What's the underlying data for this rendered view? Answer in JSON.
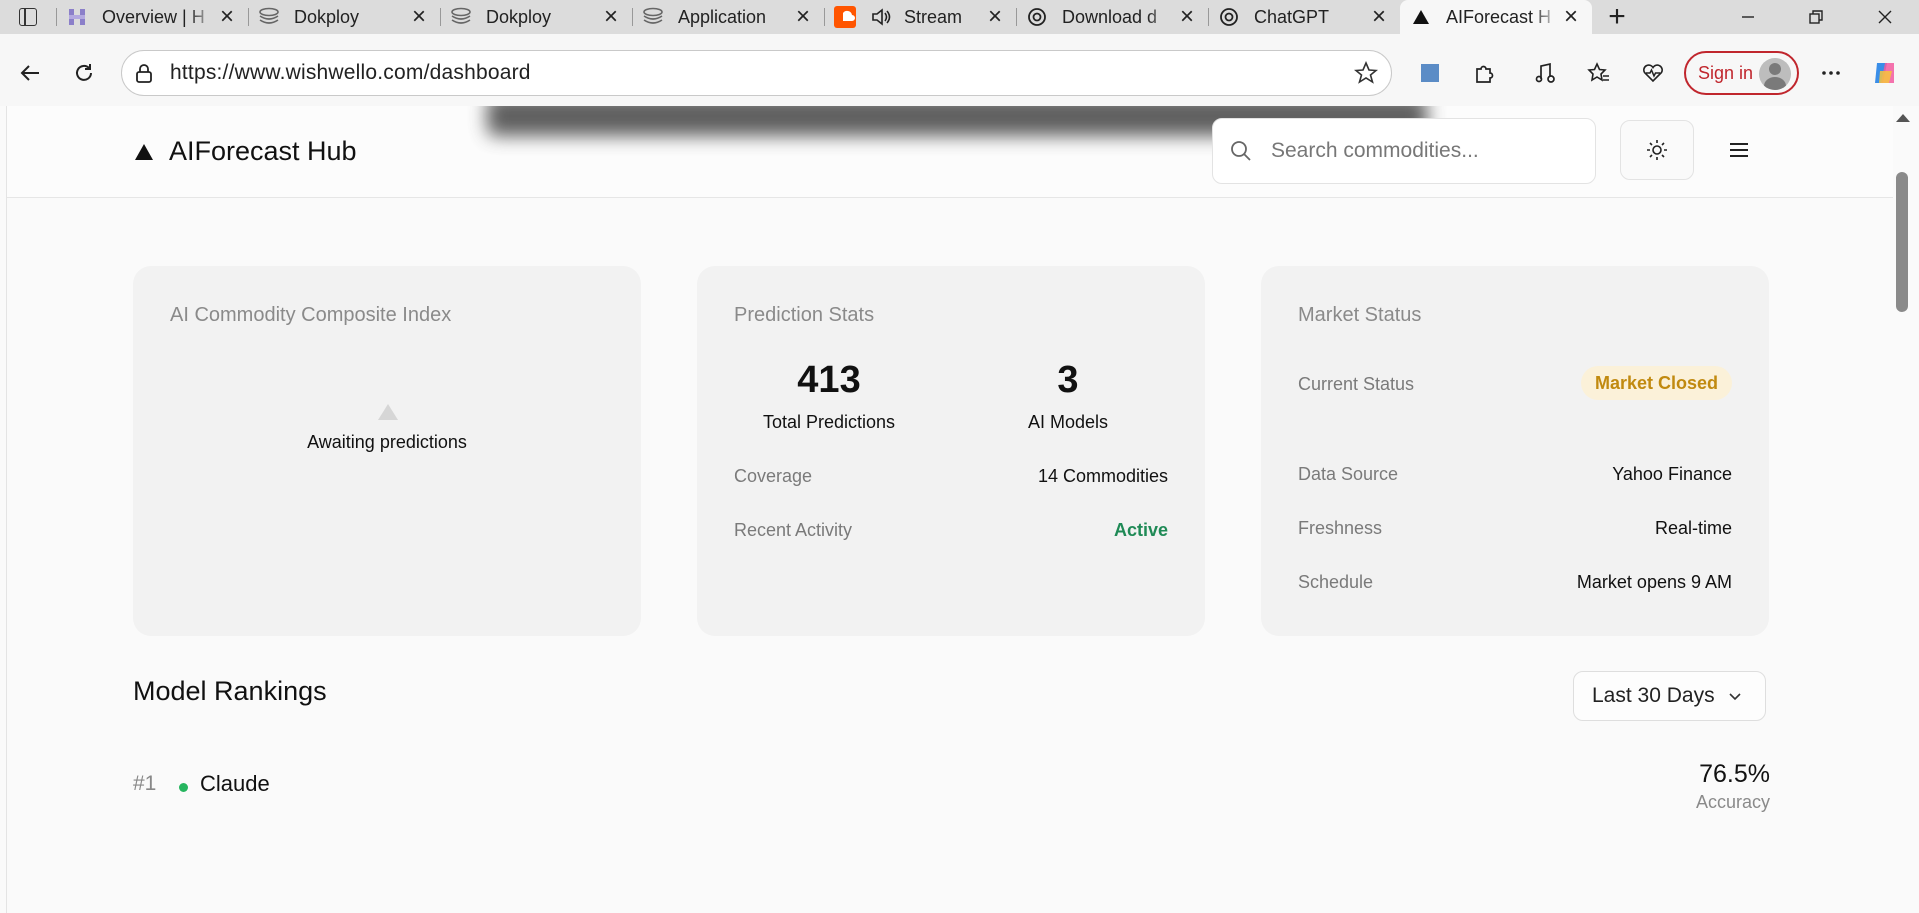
{
  "browser": {
    "tabs": [
      {
        "label": "Overview | H",
        "favicon": "h-logo-icon"
      },
      {
        "label": "Dokploy",
        "favicon": "dokploy-icon"
      },
      {
        "label": "Dokploy",
        "favicon": "dokploy-icon"
      },
      {
        "label": "Application",
        "favicon": "dokploy-icon"
      },
      {
        "label": "Stream",
        "favicon": "soundcloud-icon"
      },
      {
        "label": "Download d",
        "favicon": "openai-icon"
      },
      {
        "label": "ChatGPT",
        "favicon": "openai-icon"
      },
      {
        "label": "AIForecast H",
        "favicon": "triangle-icon",
        "active": true
      }
    ],
    "url": "https://www.wishwello.com/dashboard",
    "signin_label": "Sign in"
  },
  "header": {
    "brand": "AIForecast Hub",
    "search_placeholder": "Search commodities..."
  },
  "cards": {
    "composite": {
      "title": "AI Commodity Composite Index",
      "empty_text": "Awaiting predictions"
    },
    "prediction_stats": {
      "title": "Prediction Stats",
      "total_predictions": "413",
      "total_predictions_label": "Total Predictions",
      "ai_models": "3",
      "ai_models_label": "AI Models",
      "coverage_label": "Coverage",
      "coverage_value": "14 Commodities",
      "activity_label": "Recent Activity",
      "activity_value": "Active"
    },
    "market_status": {
      "title": "Market Status",
      "current_status_label": "Current Status",
      "current_status_value": "Market Closed",
      "data_source_label": "Data Source",
      "data_source_value": "Yahoo Finance",
      "freshness_label": "Freshness",
      "freshness_value": "Real-time",
      "schedule_label": "Schedule",
      "schedule_value": "Market opens 9 AM"
    }
  },
  "rankings": {
    "title": "Model Rankings",
    "period": "Last 30 Days",
    "items": [
      {
        "rank": "#1",
        "name": "Claude",
        "value": "76.5%",
        "sub": "Accuracy"
      }
    ]
  },
  "colors": {
    "accent_red": "#c0262d",
    "status_closed": "#c18a10",
    "status_active": "#1f8a56",
    "rank_dot": "#26b55f"
  }
}
